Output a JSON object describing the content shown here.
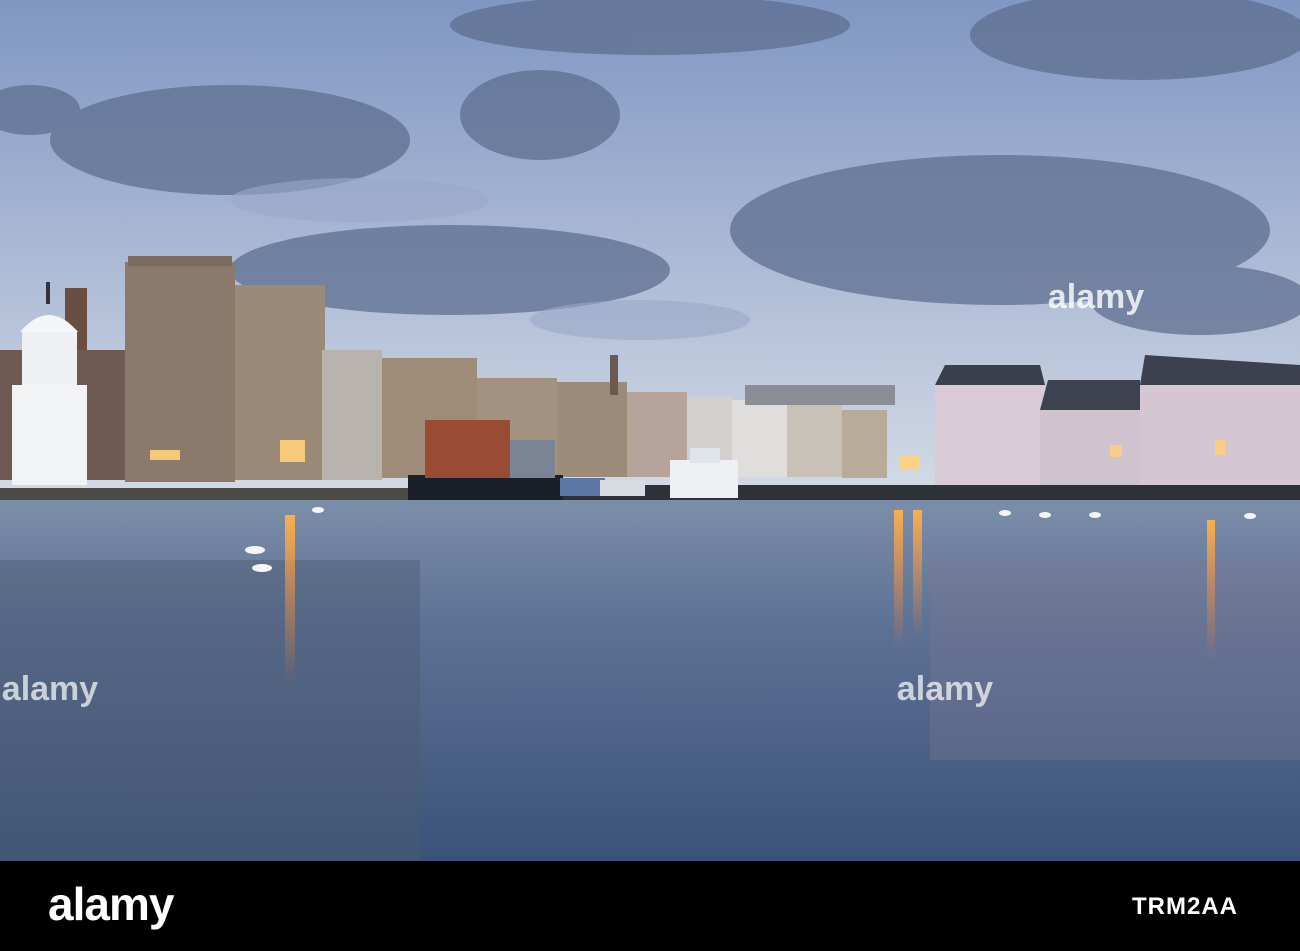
{
  "photo": {
    "subject": "harbour-at-dusk",
    "watermark": "alamy"
  },
  "footer": {
    "brand": "alamy",
    "image_id": "TRM2AA"
  },
  "colors": {
    "sky_top": "#8ea3c8",
    "sky_bottom": "#c9d3e2",
    "water": "#5a6f90",
    "footer_bg": "#000000",
    "lamp_glow": "#ff9a3c"
  }
}
